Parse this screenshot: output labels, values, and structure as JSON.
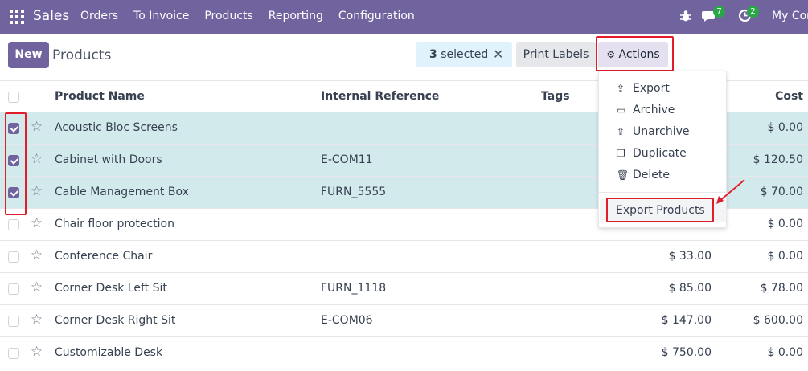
{
  "topbar": {
    "brand": "Sales",
    "menu": [
      "Orders",
      "To Invoice",
      "Products",
      "Reporting",
      "Configuration"
    ],
    "chat_badge": "7",
    "activity_badge": "2",
    "company": "My Com"
  },
  "control": {
    "new_label": "New",
    "title": "Products",
    "selected_count": "3",
    "selected_label": " selected",
    "clear_icon": "close-icon",
    "print_labels": "Print Labels",
    "actions_label": "Actions"
  },
  "columns": {
    "name": "Product Name",
    "ref": "Internal Reference",
    "tags": "Tags",
    "cost": "Cost"
  },
  "rows": [
    {
      "name": "Acoustic Bloc Screens",
      "ref": "",
      "price": "",
      "cost": "$ 0.00",
      "selected": true
    },
    {
      "name": "Cabinet with Doors",
      "ref": "E-COM11",
      "price": "",
      "cost": "$ 120.50",
      "selected": true
    },
    {
      "name": "Cable Management Box",
      "ref": "FURN_5555",
      "price": "",
      "cost": "$ 70.00",
      "selected": true
    },
    {
      "name": "Chair floor protection",
      "ref": "",
      "price": "",
      "cost": "$ 0.00",
      "selected": false
    },
    {
      "name": "Conference Chair",
      "ref": "",
      "price": "$ 33.00",
      "cost": "$ 0.00",
      "selected": false
    },
    {
      "name": "Corner Desk Left Sit",
      "ref": "FURN_1118",
      "price": "$ 85.00",
      "cost": "$ 78.00",
      "selected": false
    },
    {
      "name": "Corner Desk Right Sit",
      "ref": "E-COM06",
      "price": "$ 147.00",
      "cost": "$ 600.00",
      "selected": false
    },
    {
      "name": "Customizable Desk",
      "ref": "",
      "price": "$ 750.00",
      "cost": "$ 0.00",
      "selected": false
    }
  ],
  "actions_menu": {
    "items": [
      "Export",
      "Archive",
      "Unarchive",
      "Duplicate",
      "Delete"
    ],
    "icons": [
      "upload-icon",
      "archive-icon",
      "unarchive-icon",
      "duplicate-icon",
      "trash-icon"
    ],
    "export_products": "Export Products"
  },
  "colors": {
    "brand": "#71639e",
    "selected_row": "#d3eaed",
    "highlight": "#e11d2a",
    "badge": "#28a745"
  }
}
